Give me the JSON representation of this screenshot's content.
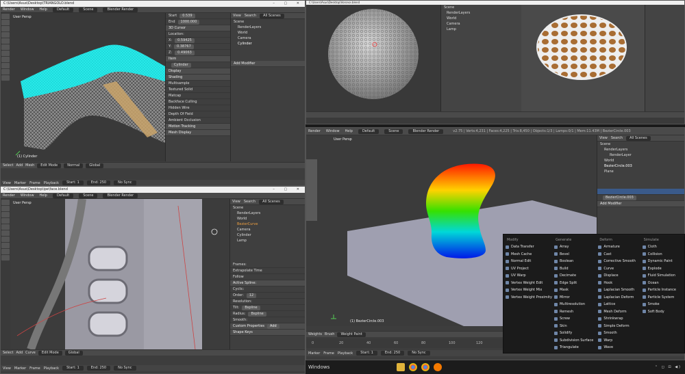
{
  "win1": {
    "title": "C:\\Users\\Asus\\Desktop\\TRIANGOLO.blend",
    "menu": [
      "Render",
      "Window",
      "Help"
    ],
    "layout": "Default",
    "scene": "Scene",
    "engine": "Blender Render",
    "viewport_label": "User Persp",
    "object_label": "(1) Cylinder",
    "toolbar": [
      "Select",
      "Add",
      "Mesh",
      "Edit Mode",
      "Normal",
      "Global"
    ],
    "timeline": [
      "View",
      "Marker",
      "Frame",
      "Playback",
      "Start:",
      "1",
      "End:",
      "250",
      "No Sync"
    ],
    "tool_panel": [
      "Start",
      "End",
      "3D Cursor",
      "Location:",
      "X:",
      "Y:",
      "Z:",
      "Item",
      "Cylinder",
      "Display",
      "Shading",
      "Multisample",
      "Textured Solid",
      "Matcap",
      "Backface Culling",
      "Hidden Wire",
      "Depth Of Field",
      "Ambient Occlusion",
      "Motion Tracking",
      "Mesh Display"
    ],
    "tool_values": [
      "0.539",
      "1000.000",
      "0.59425",
      "0.38767",
      "0.49063"
    ],
    "outliner": [
      "View",
      "Search",
      "All Scenes",
      "Scene",
      "RenderLayers",
      "World",
      "Camera",
      "Cylinder"
    ],
    "props_header": "Add Modifier"
  },
  "win2": {
    "title": "C:\\Users\\Asus\\Desktop\\ipe\\face.blend",
    "menu": [
      "Render",
      "Window",
      "Help"
    ],
    "layout": "Default",
    "scene": "Scene",
    "engine": "Blender Render",
    "viewport_label": "User Persp",
    "toolbar": [
      "Select",
      "Add",
      "Curve",
      "Edit Mode",
      "Global"
    ],
    "timeline": [
      "View",
      "Marker",
      "Frame",
      "Playback",
      "Start:",
      "1",
      "End:",
      "250",
      "No Sync"
    ],
    "outliner": [
      "View",
      "Search",
      "All Scenes",
      "Scene",
      "RenderLayers",
      "World",
      "BezierCurve",
      "Camera",
      "Cylinder",
      "Lamp"
    ],
    "props": [
      "Frames:",
      "Extrapolate Time",
      "Follow",
      "Active Spline:",
      "Cyclic:",
      "Order:",
      "Resolution:",
      "Tilt:",
      "Radius:",
      "Smooth:",
      "Custom Properties",
      "Shape Keys"
    ],
    "prop_values": [
      "12",
      "Bspline",
      "Bspline",
      "Add"
    ]
  },
  "win3": {
    "title": "C:\\Users\\Asus\\Desktop\\Voronoi.blend",
    "outliner": [
      "Scene",
      "RenderLayers",
      "World",
      "Camera",
      "Lamp"
    ]
  },
  "win4": {
    "menu": [
      "Render",
      "Window",
      "Help"
    ],
    "layout": "Default",
    "scene": "Scene",
    "engine": "Blender Render",
    "stats": "v2.75 | Verts:4,231 | Faces:4,225 | Tris:8,450 | Objects:1/3 | Lamps:0/1 | Mem:11.43M | BezierCircle.003",
    "viewport_label": "User Persp",
    "object_label": "(1) BezierCircle.003",
    "toolbar": [
      "Weights",
      "Brush",
      "Weight Paint"
    ],
    "timeline": [
      "Marker",
      "Frame",
      "Playback",
      "Start:",
      "1",
      "End:",
      "250",
      "No Sync"
    ],
    "ruler": [
      "0",
      "20",
      "40",
      "60",
      "80",
      "100",
      "120",
      "140",
      "160",
      "180",
      "200",
      "220",
      "240",
      "250"
    ],
    "outliner_header": [
      "View",
      "Search",
      "All Scenes"
    ],
    "outliner": [
      "Scene",
      "RenderLayers",
      "RenderLayer",
      "World",
      "BezierCircle.003",
      "Plane"
    ],
    "object_name": "BezierCircle.003",
    "props_header": "Add Modifier"
  },
  "modifier_menu": {
    "columns": [
      {
        "title": "Modify",
        "items": [
          "Data Transfer",
          "Mesh Cache",
          "Normal Edit",
          "UV Project",
          "UV Warp",
          "Vertex Weight Edit",
          "Vertex Weight Mix",
          "Vertex Weight Proximity"
        ]
      },
      {
        "title": "Generate",
        "items": [
          "Array",
          "Bevel",
          "Boolean",
          "Build",
          "Decimate",
          "Edge Split",
          "Mask",
          "Mirror",
          "Multiresolution",
          "Remesh",
          "Screw",
          "Skin",
          "Solidify",
          "Subdivision Surface",
          "Triangulate"
        ]
      },
      {
        "title": "Deform",
        "items": [
          "Armature",
          "Cast",
          "Corrective Smooth",
          "Curve",
          "Displace",
          "Hook",
          "Laplacian Smooth",
          "Laplacian Deform",
          "Lattice",
          "Mesh Deform",
          "Shrinkwrap",
          "Simple Deform",
          "Smooth",
          "Warp",
          "Wave"
        ]
      },
      {
        "title": "Simulate",
        "items": [
          "Cloth",
          "Collision",
          "Dynamic Paint",
          "Explode",
          "Fluid Simulation",
          "Ocean",
          "Particle Instance",
          "Particle System",
          "Smoke",
          "Soft Body"
        ]
      }
    ]
  },
  "taskbar": {
    "start": "Windows",
    "icons": [
      "folder-icon",
      "chrome-icon",
      "chrome-icon-2",
      "blender-icon"
    ],
    "tray": "⌃ ◻ ⊡ ◀)"
  }
}
